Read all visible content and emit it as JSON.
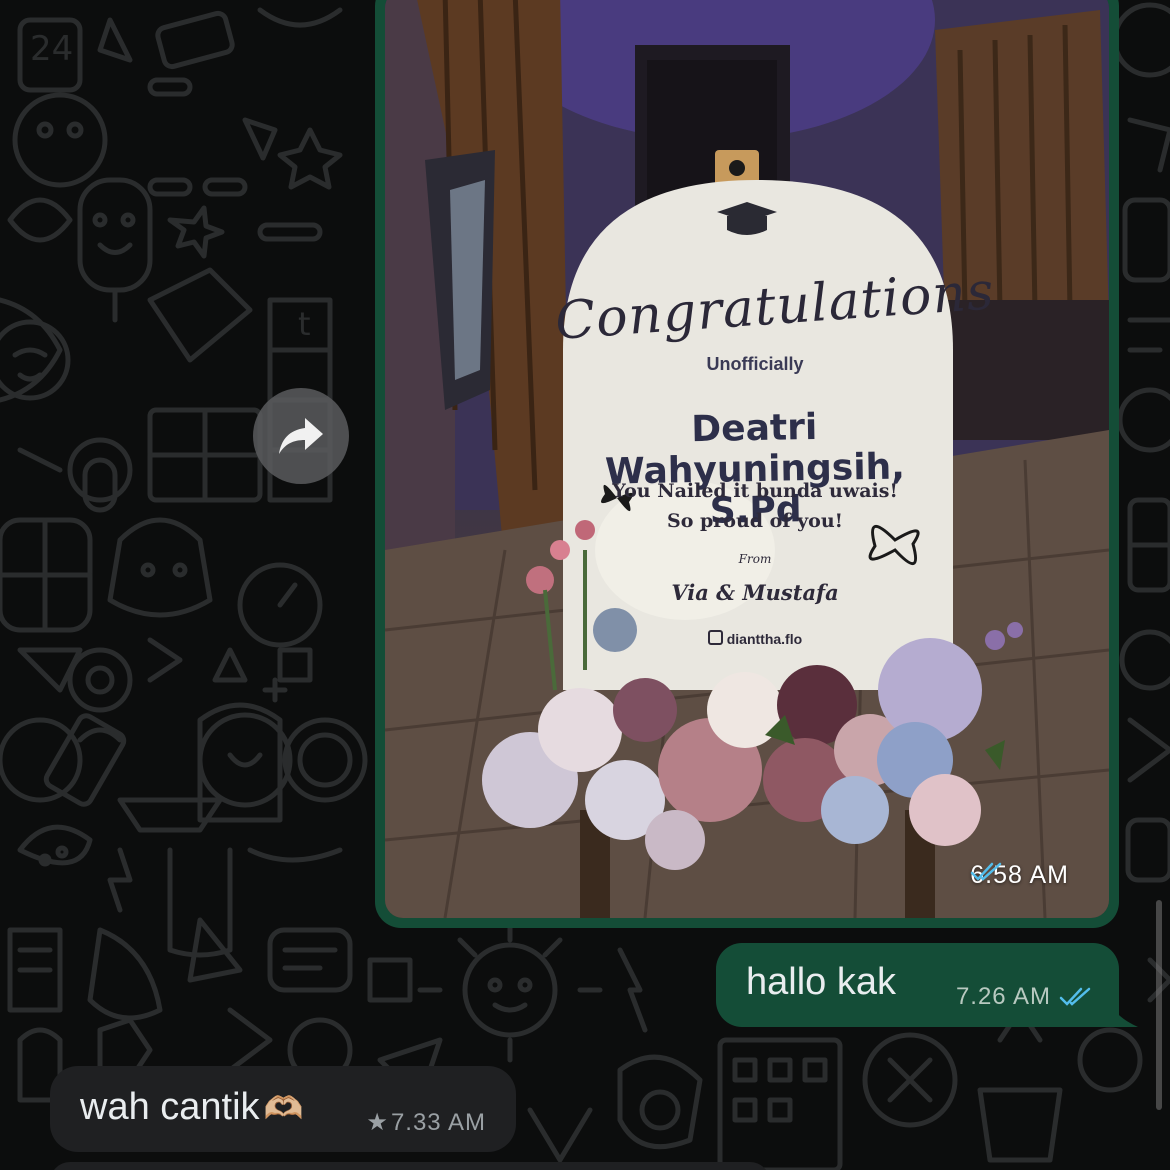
{
  "messages": {
    "image_message": {
      "time": "6.58 AM",
      "status": "read",
      "photo_sign": {
        "title": "Congratulations",
        "subtitle": "Unofficially",
        "name": "Deatri Wahyuningsih, S.Pd",
        "message_line1": "You Nailed it bunda uwais!",
        "message_line2": "So proud of you!",
        "from_label": "From",
        "from_names": "Via & Mustafa",
        "instagram": "dianttha.flo"
      }
    },
    "outgoing_text": {
      "text": "hallo kak",
      "time": "7.26 AM",
      "status": "read"
    },
    "incoming_text": {
      "text": "wah cantik",
      "emoji": "🫶🏼",
      "starred": true,
      "time": "7.33 AM"
    }
  },
  "icons": {
    "forward": "forward-arrow-icon",
    "read_receipt": "double-check-icon",
    "star": "star-icon"
  },
  "colors": {
    "outgoing_bubble": "#144d37",
    "incoming_bubble": "#1f2022",
    "read_tick": "#53bdeb",
    "background": "#0c0d0d"
  }
}
